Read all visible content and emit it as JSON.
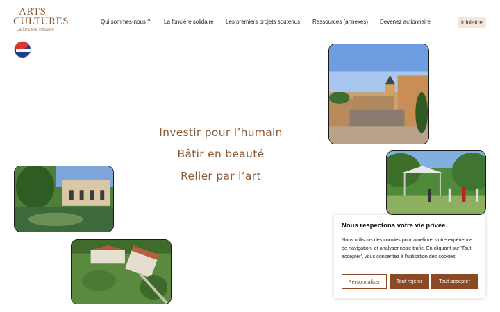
{
  "logo": {
    "line1": "ARTS",
    "line2": "CULTURES",
    "line3": "La foncière solidaire"
  },
  "nav": [
    "Qui sommes-nous ?",
    "La foncière solidaire",
    "Les premiers projets soutenus",
    "Ressources (annexes)",
    "Devenez actionnaire"
  ],
  "newsletter_label": "infolettre",
  "taglines": [
    "Investir pour l’humain",
    "Bâtir en beauté",
    "Relier par l’art"
  ],
  "cookie": {
    "title": "Nous respectons votre vie privée.",
    "text": "Nous utilisons des cookies pour améliorer votre expérience de navigation, et analyser notre trafic. En cliquant sur 'Tout accepter', vous consentez à l'utilisation des cookies.",
    "customize": "Personnaliser",
    "reject": "Tout rejeter",
    "accept": "Tout accepter"
  },
  "colors": {
    "brand": "#8a5a36",
    "button": "#8a4a26",
    "newsletter_bg": "#f3e7dd"
  }
}
